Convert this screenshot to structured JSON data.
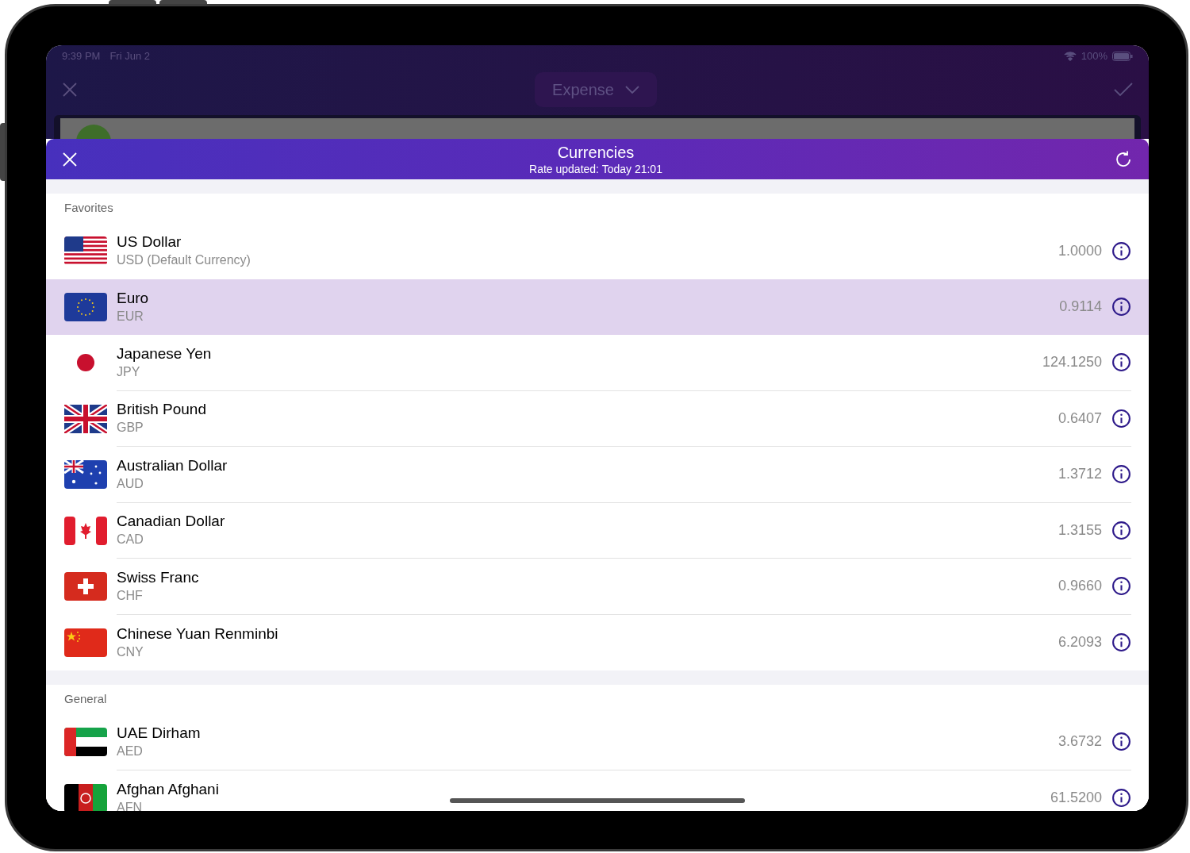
{
  "status_bar": {
    "time": "9:39 PM",
    "date": "Fri Jun 2",
    "battery": "100%"
  },
  "background_nav": {
    "title": "Expense"
  },
  "sheet": {
    "title": "Currencies",
    "subtitle": "Rate updated: Today 21:01"
  },
  "sections": [
    {
      "title": "Favorites",
      "items": [
        {
          "name": "US Dollar",
          "code": "USD (Default Currency)",
          "rate": "1.0000",
          "kind": "us",
          "selected": false
        },
        {
          "name": "Euro",
          "code": "EUR",
          "rate": "0.9114",
          "kind": "eu",
          "selected": true
        },
        {
          "name": "Japanese Yen",
          "code": "JPY",
          "rate": "124.1250",
          "kind": "jp",
          "selected": false
        },
        {
          "name": "British Pound",
          "code": "GBP",
          "rate": "0.6407",
          "kind": "gb",
          "selected": false
        },
        {
          "name": "Australian Dollar",
          "code": "AUD",
          "rate": "1.3712",
          "kind": "au",
          "selected": false
        },
        {
          "name": "Canadian Dollar",
          "code": "CAD",
          "rate": "1.3155",
          "kind": "ca",
          "selected": false
        },
        {
          "name": "Swiss Franc",
          "code": "CHF",
          "rate": "0.9660",
          "kind": "ch",
          "selected": false
        },
        {
          "name": "Chinese Yuan Renminbi",
          "code": "CNY",
          "rate": "6.2093",
          "kind": "cn",
          "selected": false
        }
      ]
    },
    {
      "title": "General",
      "items": [
        {
          "name": "UAE Dirham",
          "code": "AED",
          "rate": "3.6732",
          "kind": "ae",
          "selected": false
        },
        {
          "name": "Afghan Afghani",
          "code": "AFN",
          "rate": "61.5200",
          "kind": "af",
          "selected": false
        }
      ]
    }
  ]
}
